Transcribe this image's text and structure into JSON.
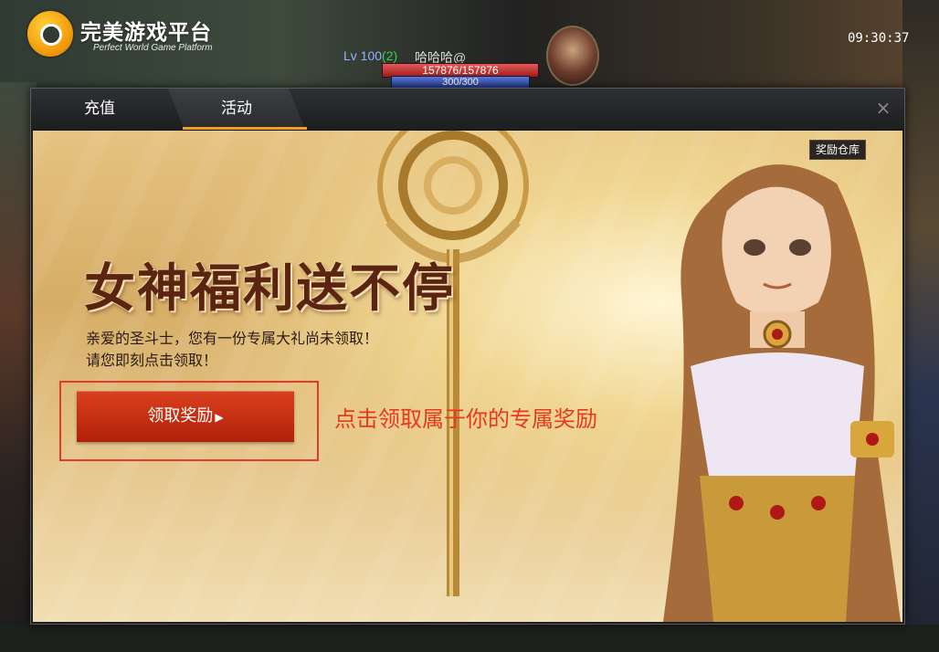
{
  "platform": {
    "title": "完美游戏平台",
    "subtitle": "Perfect World Game Platform"
  },
  "player": {
    "level_prefix": "Lv 100",
    "level_sub": "(2)",
    "name": "哈哈哈@",
    "hp": "157876/157876",
    "mp": "300/300"
  },
  "clock": "09:30:37",
  "dialog": {
    "tabs": [
      {
        "label": "充值"
      },
      {
        "label": "活动"
      }
    ],
    "active_tab": "活动",
    "close_label": "×"
  },
  "banner": {
    "reward_warehouse": "奖励仓库",
    "headline": "女神福利送不停",
    "line1": "亲爱的圣斗士，您有一份专属大礼尚未领取！",
    "line2": "请您即刻点击领取！",
    "claim_button": "领取奖励",
    "claim_arrow": "▶",
    "annotation": "点击领取属于你的专属奖励"
  },
  "colors": {
    "accent_orange": "#f0a020",
    "button_red": "#c22f12",
    "annotation_red": "#e8391f",
    "headline_brown": "#5a2410"
  }
}
